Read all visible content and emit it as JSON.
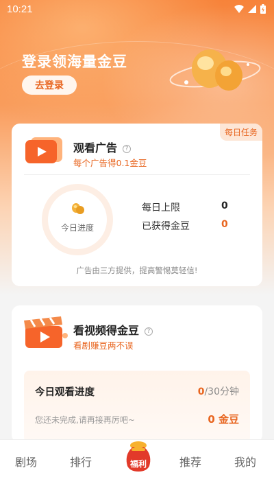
{
  "status_bar": {
    "time": "10:21"
  },
  "banner": {
    "title": "登录领海量金豆",
    "login_button": "去登录"
  },
  "ad_card": {
    "tag": "每日任务",
    "title": "观看广告",
    "help": "?",
    "subtitle": "每个广告得0.1金豆",
    "progress_label": "今日进度",
    "daily_limit_label": "每日上限",
    "daily_limit_value": "0",
    "earned_label": "已获得金豆",
    "earned_value": "0",
    "footnote": "广告由三方提供，提高警惕莫轻信!"
  },
  "video_card": {
    "title": "看视频得金豆",
    "help": "?",
    "subtitle": "看剧赚豆两不误",
    "progress_title": "今日观看进度",
    "progress_watched": "0",
    "progress_total": "/30分钟",
    "hint": "您还未完成,请再接再厉吧~",
    "beans": "0 金豆"
  },
  "tabs": [
    {
      "label": "剧场"
    },
    {
      "label": "排行"
    },
    {
      "label": "福利"
    },
    {
      "label": "推荐"
    },
    {
      "label": "我的"
    }
  ],
  "colors": {
    "accent": "#e8651f",
    "hero_top": "#f7833a",
    "tag_bg": "#fde6d6"
  },
  "icons": [
    "wifi-icon",
    "signal-icon",
    "battery-icon",
    "ad-play-icon",
    "gold-bean-icon",
    "video-clapper-icon",
    "lucky-bag-icon"
  ]
}
